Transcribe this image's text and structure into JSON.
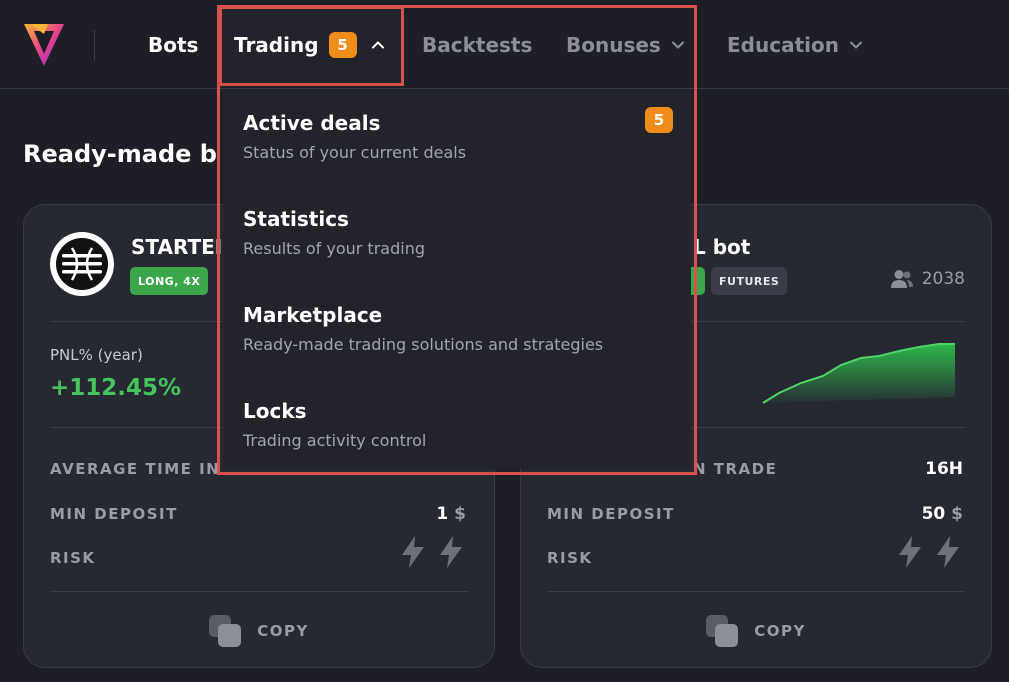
{
  "nav": {
    "bots": "Bots",
    "trading": "Trading",
    "trading_badge": "5",
    "backtests": "Backtests",
    "bonuses": "Bonuses",
    "education": "Education"
  },
  "page": {
    "title": "Ready-made b"
  },
  "dropdown": {
    "items": [
      {
        "title": "Active deals",
        "subtitle": "Status of your current deals",
        "badge": "5"
      },
      {
        "title": "Statistics",
        "subtitle": "Results of your trading"
      },
      {
        "title": "Marketplace",
        "subtitle": "Ready-made trading solutions and strategies"
      },
      {
        "title": "Locks",
        "subtitle": "Trading activity control"
      }
    ]
  },
  "cards": [
    {
      "name": "STARTEI",
      "tags": [
        "LONG, 4X"
      ],
      "pnl_label": "PNL% (year)",
      "pnl_value": "+112.45%",
      "avg_time_label": "AVERAGE TIME IN",
      "min_deposit_label": "MIN DEPOSIT",
      "min_deposit_value": "1",
      "min_deposit_unit": "$",
      "risk_label": "RISK",
      "copy_label": "COPY"
    },
    {
      "name": "L bot",
      "tags": [
        "FUTURES"
      ],
      "users": "2038",
      "avg_time_label": "N TRADE",
      "avg_time_value": "16H",
      "min_deposit_label": "MIN DEPOSIT",
      "min_deposit_value": "50",
      "min_deposit_unit": "$",
      "risk_label": "RISK",
      "copy_label": "COPY"
    }
  ],
  "colors": {
    "accent_orange": "#f08c1a",
    "positive_green": "#45c45c",
    "highlight_red": "#d6524a",
    "background": "#1e1f26"
  }
}
